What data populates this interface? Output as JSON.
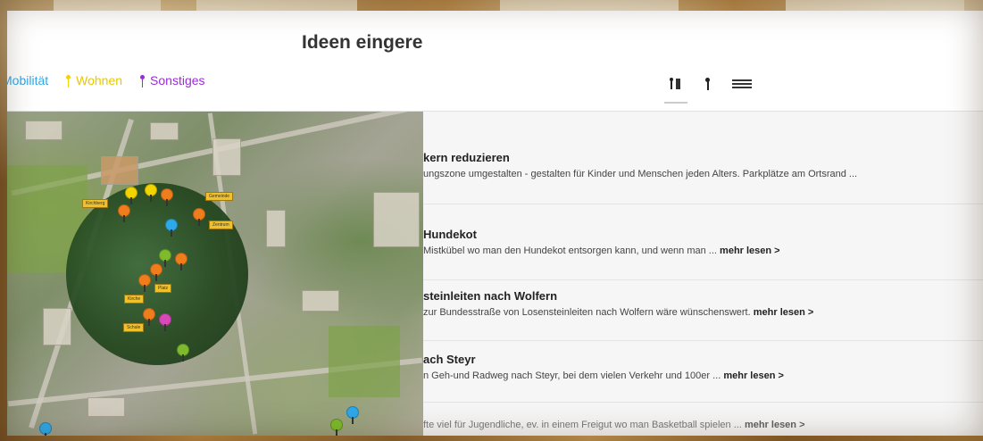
{
  "header": {
    "title": "Ideen eingere"
  },
  "filters": [
    {
      "label": "Mobilität",
      "color": "#2ea8e8"
    },
    {
      "label": "Wohnen",
      "color": "#f2d500"
    },
    {
      "label": "Sonstiges",
      "color": "#9b2bd8"
    }
  ],
  "view_toggles": [
    {
      "icon": "map-list-icon",
      "active": true
    },
    {
      "icon": "map-pin-icon",
      "active": false
    },
    {
      "icon": "list-icon",
      "active": false
    }
  ],
  "ideas": [
    {
      "title": "kern reduzieren",
      "text": "ungszone umgestalten - gestalten für Kinder und Menschen jeden Alters. Parkplätze am Ortsrand ...",
      "more": ""
    },
    {
      "title": "Hundekot",
      "text": "Mistkübel wo man den Hundekot entsorgen kann, und wenn man ...",
      "more": "mehr lesen >"
    },
    {
      "title": "steinleiten nach Wolfern",
      "text": "zur Bundesstraße von Losensteinleiten nach Wolfern wäre wünschenswert.",
      "more": "mehr lesen >"
    },
    {
      "title": "ach Steyr",
      "text": "n Geh-und Radweg nach Steyr, bei dem vielen Verkehr und 100er ...",
      "more": "mehr lesen >"
    },
    {
      "title": "",
      "text": "fte viel für Jugendliche, ev. in einem Freigut wo man Basketball spielen ...",
      "more": "mehr lesen >"
    }
  ],
  "colors": {
    "mobility": "#2ea8e8",
    "housing": "#f2d500",
    "other": "#9b2bd8",
    "orange": "#f07d1c",
    "green": "#7dbb2c",
    "pink": "#d848b8"
  }
}
